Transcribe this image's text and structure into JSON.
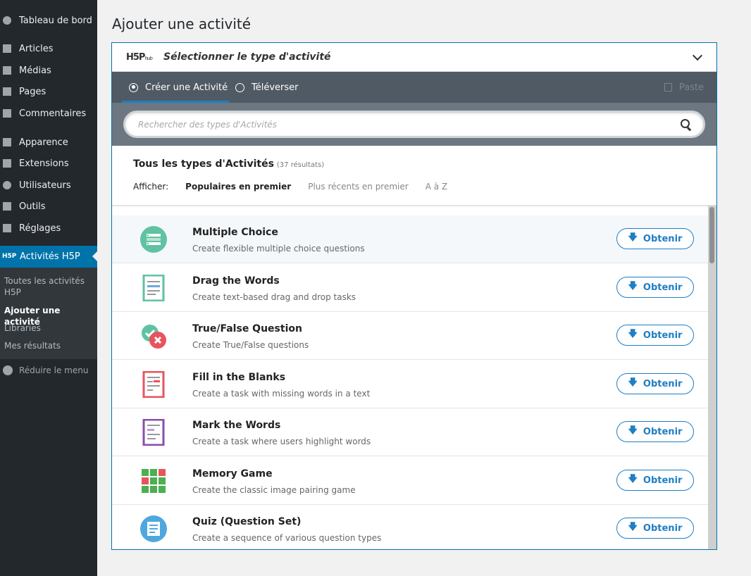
{
  "sidebar": {
    "items": [
      {
        "label": "Tableau de bord",
        "icon": "dashboard-icon"
      },
      {
        "label": "Articles",
        "icon": "pin-icon"
      },
      {
        "label": "Médias",
        "icon": "media-icon"
      },
      {
        "label": "Pages",
        "icon": "page-icon"
      },
      {
        "label": "Commentaires",
        "icon": "comment-icon"
      },
      {
        "label": "Apparence",
        "icon": "brush-icon"
      },
      {
        "label": "Extensions",
        "icon": "plugin-icon"
      },
      {
        "label": "Utilisateurs",
        "icon": "user-icon"
      },
      {
        "label": "Outils",
        "icon": "wrench-icon"
      },
      {
        "label": "Réglages",
        "icon": "settings-icon"
      }
    ],
    "h5p": {
      "label": "Activités H5P",
      "logo": "H5P"
    },
    "submenu": [
      {
        "label": "Toutes les activités H5P"
      },
      {
        "label": "Ajouter une activité"
      },
      {
        "label": "Libraries"
      },
      {
        "label": "Mes résultats"
      }
    ],
    "collapse_label": "Réduire le menu"
  },
  "page": {
    "title": "Ajouter une activité"
  },
  "hub": {
    "logo": "H5P",
    "logo_sub": "hub",
    "title": "Sélectionner le type d'activité",
    "tabs": {
      "create": "Créer une Activité",
      "upload": "Téléverser"
    },
    "paste": "Paste",
    "search_placeholder": "Rechercher des types d'Activités",
    "results_title": "Tous les types d'Activités",
    "results_count": "(37 résultats)",
    "sort_label": "Afficher:",
    "sort_options": [
      "Populaires en premier",
      "Plus récents en premier",
      "A à Z"
    ],
    "get_label": "Obtenir",
    "items": [
      {
        "title": "Multiple Choice",
        "desc": "Create flexible multiple choice questions",
        "icon": "multiple-choice-icon"
      },
      {
        "title": "Drag the Words",
        "desc": "Create text-based drag and drop tasks",
        "icon": "drag-words-icon"
      },
      {
        "title": "True/False Question",
        "desc": "Create True/False questions",
        "icon": "true-false-icon"
      },
      {
        "title": "Fill in the Blanks",
        "desc": "Create a task with missing words in a text",
        "icon": "fill-blanks-icon"
      },
      {
        "title": "Mark the Words",
        "desc": "Create a task where users highlight words",
        "icon": "mark-words-icon"
      },
      {
        "title": "Memory Game",
        "desc": "Create the classic image pairing game",
        "icon": "memory-game-icon"
      },
      {
        "title": "Quiz (Question Set)",
        "desc": "Create a sequence of various question types",
        "icon": "quiz-icon"
      }
    ]
  }
}
